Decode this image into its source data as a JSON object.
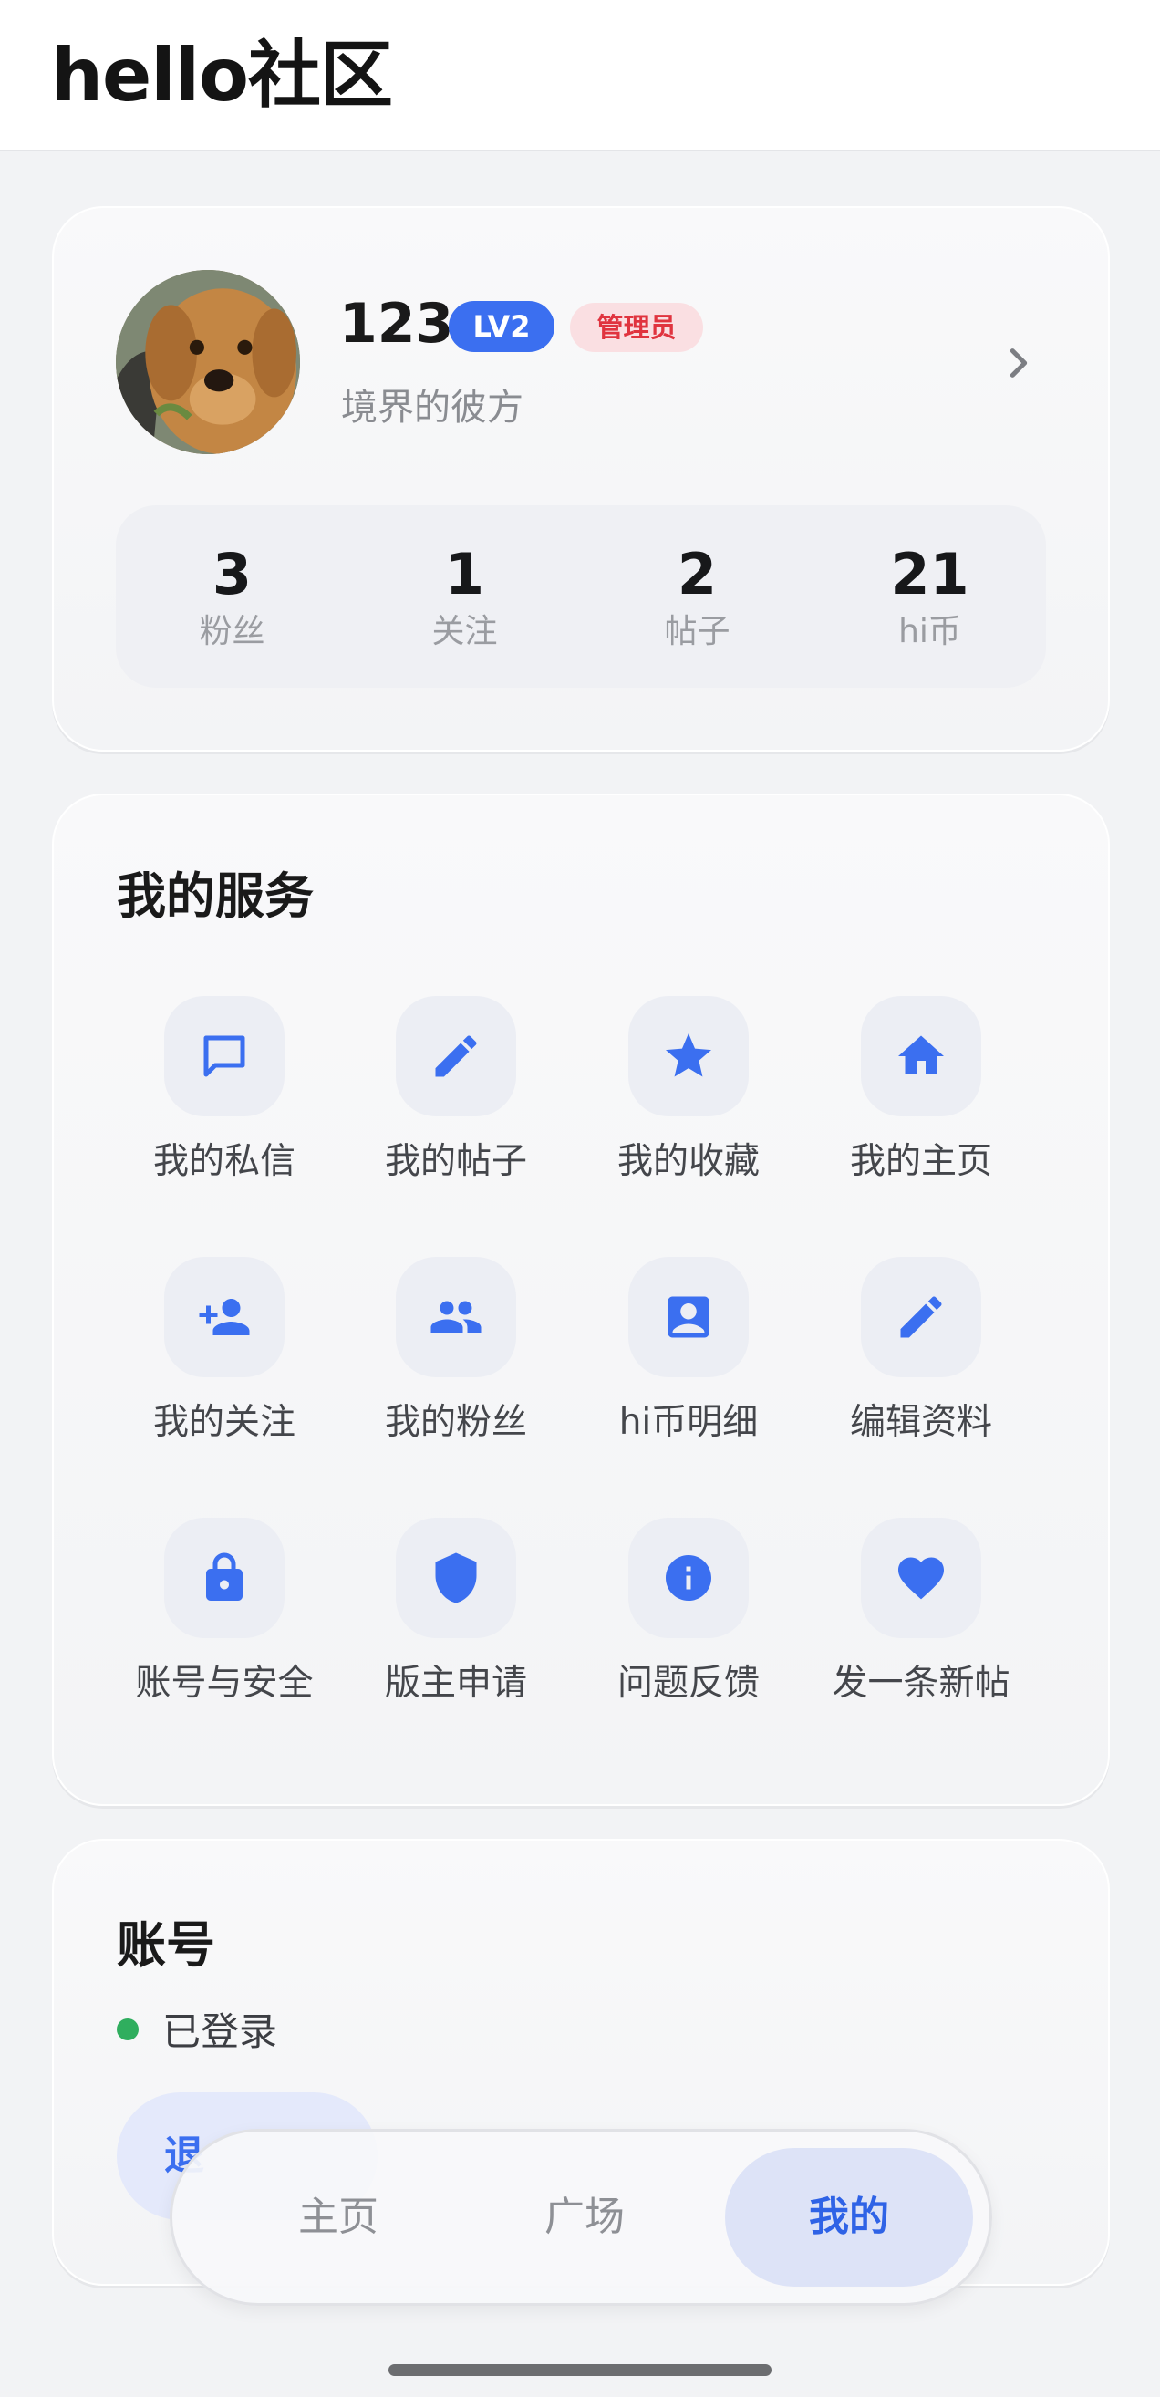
{
  "app": {
    "title": "hello社区"
  },
  "profile": {
    "username": "123",
    "level_badge": "LV2",
    "role_badge": "管理员",
    "bio": "境界的彼方",
    "stats": [
      {
        "value": "3",
        "label": "粉丝"
      },
      {
        "value": "1",
        "label": "关注"
      },
      {
        "value": "2",
        "label": "帖子"
      },
      {
        "value": "21",
        "label": "hi币"
      }
    ]
  },
  "services": {
    "title": "我的服务",
    "items": [
      {
        "label": "我的私信",
        "icon": "message-icon"
      },
      {
        "label": "我的帖子",
        "icon": "pencil-icon"
      },
      {
        "label": "我的收藏",
        "icon": "star-icon"
      },
      {
        "label": "我的主页",
        "icon": "home-icon"
      },
      {
        "label": "我的关注",
        "icon": "person-add-icon"
      },
      {
        "label": "我的粉丝",
        "icon": "group-icon"
      },
      {
        "label": "hi币明细",
        "icon": "contact-card-icon"
      },
      {
        "label": "编辑资料",
        "icon": "pencil-icon"
      },
      {
        "label": "账号与安全",
        "icon": "lock-icon"
      },
      {
        "label": "版主申请",
        "icon": "shield-icon"
      },
      {
        "label": "问题反馈",
        "icon": "info-icon"
      },
      {
        "label": "发一条新帖",
        "icon": "heart-icon"
      }
    ]
  },
  "account": {
    "title": "账号",
    "status": "已登录",
    "logout_label": "退"
  },
  "tabbar": {
    "tabs": [
      {
        "label": "主页",
        "active": false
      },
      {
        "label": "广场",
        "active": false
      },
      {
        "label": "我的",
        "active": true
      }
    ]
  },
  "colors": {
    "accent": "#3b6ff0",
    "admin_badge_text": "#e0343f",
    "admin_badge_bg": "#fadfe2",
    "online_dot": "#2fae5e",
    "page_bg": "#f2f3f5"
  }
}
